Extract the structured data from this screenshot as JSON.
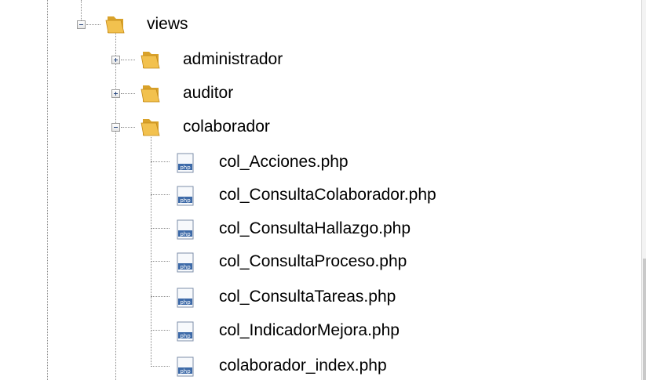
{
  "tree": {
    "views": {
      "label": "views",
      "expanded": true
    },
    "folders": [
      {
        "label": "administrador",
        "expanded": false
      },
      {
        "label": "auditor",
        "expanded": false
      },
      {
        "label": "colaborador",
        "expanded": true
      }
    ],
    "files": [
      {
        "label": "col_Acciones.php"
      },
      {
        "label": "col_ConsultaColaborador.php"
      },
      {
        "label": "col_ConsultaHallazgo.php"
      },
      {
        "label": "col_ConsultaProceso.php"
      },
      {
        "label": "col_ConsultaTareas.php"
      },
      {
        "label": "col_IndicadorMejora.php"
      },
      {
        "label": "colaborador_index.php"
      }
    ],
    "file_icon_text": "php"
  },
  "colors": {
    "folder_yellow": "#f2c14e",
    "folder_dark": "#d9a22a",
    "guide_line": "#8a8a8a",
    "php_icon_blue": "#3d6aa8"
  }
}
